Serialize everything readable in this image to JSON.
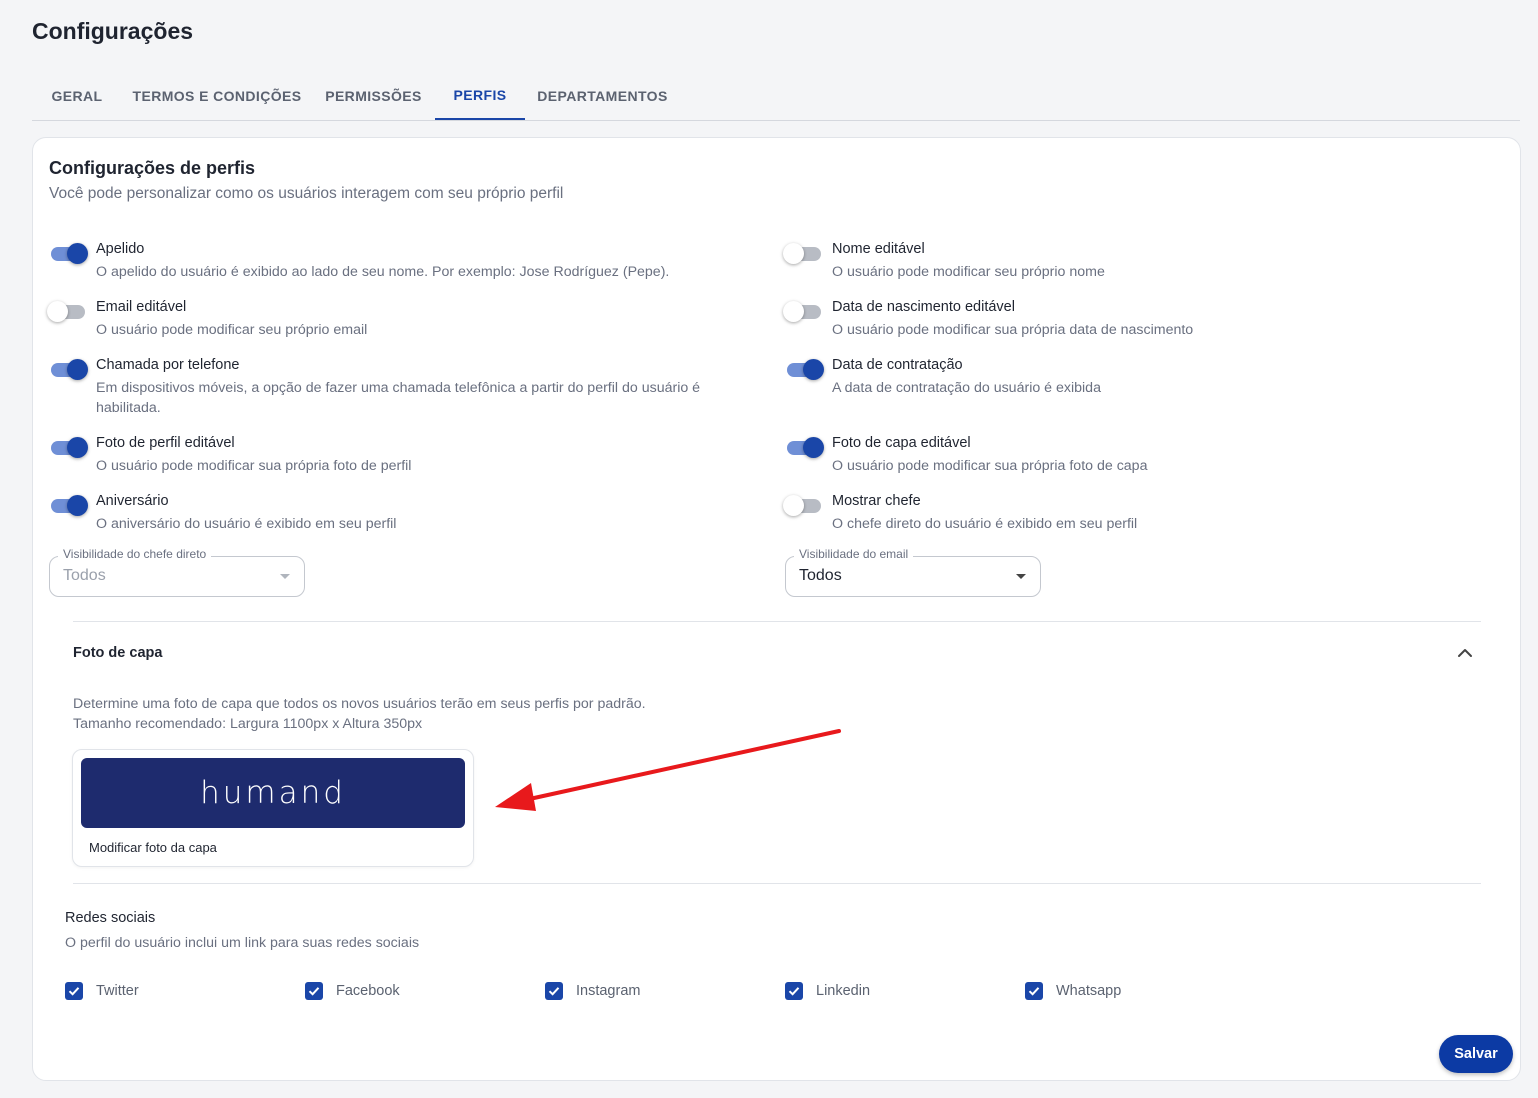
{
  "page": {
    "title": "Configurações"
  },
  "tabs": [
    {
      "label": "GERAL",
      "active": false
    },
    {
      "label": "TERMOS E CONDIÇÕES",
      "active": false
    },
    {
      "label": "PERMISSÕES",
      "active": false
    },
    {
      "label": "PERFIS",
      "active": true
    },
    {
      "label": "DEPARTAMENTOS",
      "active": false
    }
  ],
  "card": {
    "title": "Configurações de perfis",
    "subtitle": "Você pode personalizar como os usuários interagem com seu próprio perfil"
  },
  "settings_left": [
    {
      "label": "Apelido",
      "desc": "O apelido do usuário é exibido ao lado de seu nome. Por exemplo: Jose Rodríguez (Pepe).",
      "on": true
    },
    {
      "label": "Email editável",
      "desc": "O usuário pode modificar seu próprio email",
      "on": false
    },
    {
      "label": "Chamada por telefone",
      "desc": "Em dispositivos móveis, a opção de fazer uma chamada telefônica a partir do perfil do usuário é habilitada.",
      "on": true
    },
    {
      "label": "Foto de perfil editável",
      "desc": "O usuário pode modificar sua própria foto de perfil",
      "on": true
    },
    {
      "label": "Aniversário",
      "desc": "O aniversário do usuário é exibido em seu perfil",
      "on": true
    }
  ],
  "settings_right": [
    {
      "label": "Nome editável",
      "desc": "O usuário pode modificar seu próprio nome",
      "on": false
    },
    {
      "label": "Data de nascimento editável",
      "desc": "O usuário pode modificar sua própria data de nascimento",
      "on": false
    },
    {
      "label": "Data de contratação",
      "desc": "A data de contratação do usuário é exibida",
      "on": true
    },
    {
      "label": "Foto de capa editável",
      "desc": "O usuário pode modificar sua própria foto de capa",
      "on": true
    },
    {
      "label": "Mostrar chefe",
      "desc": "O chefe direto do usuário é exibido em seu perfil",
      "on": false
    }
  ],
  "boss_visibility": {
    "legend": "Visibilidade do chefe direto",
    "value": "Todos",
    "disabled": true
  },
  "email_visibility": {
    "legend": "Visibilidade do email",
    "value": "Todos",
    "disabled": false
  },
  "cover": {
    "title": "Foto de capa",
    "desc_line1": "Determine uma foto de capa que todos os novos usuários terão em seus perfis por padrão.",
    "desc_line2": "Tamanho recomendado: Largura 1100px x Altura 350px",
    "brand": "humand",
    "caption": "Modificar foto da capa",
    "expanded": true
  },
  "social": {
    "title": "Redes sociais",
    "desc": "O perfil do usuário inclui um link para suas redes sociais",
    "items": [
      {
        "label": "Twitter",
        "checked": true
      },
      {
        "label": "Facebook",
        "checked": true
      },
      {
        "label": "Instagram",
        "checked": true
      },
      {
        "label": "Linkedin",
        "checked": true
      },
      {
        "label": "Whatsapp",
        "checked": true
      }
    ]
  },
  "actions": {
    "save_label": "Salvar"
  },
  "colors": {
    "primary": "#1a46a8",
    "toggle_track_on": "#6f8fd6",
    "cover_bg": "#1e2b6e",
    "annotation_arrow": "#e8191c"
  }
}
